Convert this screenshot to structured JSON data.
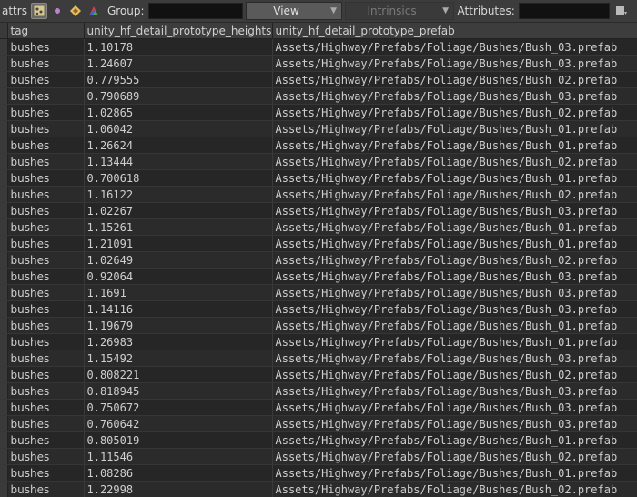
{
  "toolbar": {
    "label": "attrs",
    "group_label": "Group:",
    "group_value": "",
    "view_label": "View",
    "intrinsics_label": "Intrinsics",
    "attributes_label": "Attributes:",
    "attributes_value": ""
  },
  "table": {
    "columns": [
      "tag",
      "unity_hf_detail_prototype_heightscale",
      "unity_hf_detail_prototype_prefab"
    ],
    "rows": [
      [
        "bushes",
        "1.10178",
        "Assets/Highway/Prefabs/Foliage/Bushes/Bush_03.prefab"
      ],
      [
        "bushes",
        "1.24607",
        "Assets/Highway/Prefabs/Foliage/Bushes/Bush_03.prefab"
      ],
      [
        "bushes",
        "0.779555",
        "Assets/Highway/Prefabs/Foliage/Bushes/Bush_02.prefab"
      ],
      [
        "bushes",
        "0.790689",
        "Assets/Highway/Prefabs/Foliage/Bushes/Bush_03.prefab"
      ],
      [
        "bushes",
        "1.02865",
        "Assets/Highway/Prefabs/Foliage/Bushes/Bush_02.prefab"
      ],
      [
        "bushes",
        "1.06042",
        "Assets/Highway/Prefabs/Foliage/Bushes/Bush_01.prefab"
      ],
      [
        "bushes",
        "1.26624",
        "Assets/Highway/Prefabs/Foliage/Bushes/Bush_01.prefab"
      ],
      [
        "bushes",
        "1.13444",
        "Assets/Highway/Prefabs/Foliage/Bushes/Bush_02.prefab"
      ],
      [
        "bushes",
        "0.700618",
        "Assets/Highway/Prefabs/Foliage/Bushes/Bush_01.prefab"
      ],
      [
        "bushes",
        "1.16122",
        "Assets/Highway/Prefabs/Foliage/Bushes/Bush_02.prefab"
      ],
      [
        "bushes",
        "1.02267",
        "Assets/Highway/Prefabs/Foliage/Bushes/Bush_03.prefab"
      ],
      [
        "bushes",
        "1.15261",
        "Assets/Highway/Prefabs/Foliage/Bushes/Bush_01.prefab"
      ],
      [
        "bushes",
        "1.21091",
        "Assets/Highway/Prefabs/Foliage/Bushes/Bush_01.prefab"
      ],
      [
        "bushes",
        "1.02649",
        "Assets/Highway/Prefabs/Foliage/Bushes/Bush_02.prefab"
      ],
      [
        "bushes",
        "0.92064",
        "Assets/Highway/Prefabs/Foliage/Bushes/Bush_03.prefab"
      ],
      [
        "bushes",
        "1.1691",
        "Assets/Highway/Prefabs/Foliage/Bushes/Bush_03.prefab"
      ],
      [
        "bushes",
        "1.14116",
        "Assets/Highway/Prefabs/Foliage/Bushes/Bush_03.prefab"
      ],
      [
        "bushes",
        "1.19679",
        "Assets/Highway/Prefabs/Foliage/Bushes/Bush_01.prefab"
      ],
      [
        "bushes",
        "1.26983",
        "Assets/Highway/Prefabs/Foliage/Bushes/Bush_01.prefab"
      ],
      [
        "bushes",
        "1.15492",
        "Assets/Highway/Prefabs/Foliage/Bushes/Bush_03.prefab"
      ],
      [
        "bushes",
        "0.808221",
        "Assets/Highway/Prefabs/Foliage/Bushes/Bush_02.prefab"
      ],
      [
        "bushes",
        "0.818945",
        "Assets/Highway/Prefabs/Foliage/Bushes/Bush_03.prefab"
      ],
      [
        "bushes",
        "0.750672",
        "Assets/Highway/Prefabs/Foliage/Bushes/Bush_03.prefab"
      ],
      [
        "bushes",
        "0.760642",
        "Assets/Highway/Prefabs/Foliage/Bushes/Bush_03.prefab"
      ],
      [
        "bushes",
        "0.805019",
        "Assets/Highway/Prefabs/Foliage/Bushes/Bush_01.prefab"
      ],
      [
        "bushes",
        "1.11546",
        "Assets/Highway/Prefabs/Foliage/Bushes/Bush_02.prefab"
      ],
      [
        "bushes",
        "1.08286",
        "Assets/Highway/Prefabs/Foliage/Bushes/Bush_01.prefab"
      ],
      [
        "bushes",
        "1.22998",
        "Assets/Highway/Prefabs/Foliage/Bushes/Bush_02.prefab"
      ]
    ]
  },
  "icons": [
    "points-filter-icon",
    "point-icon",
    "vertex-icon",
    "primitive-icon",
    "options-icon"
  ],
  "colors": {
    "background": "#262626",
    "header": "#3d3d3d",
    "field": "#111111"
  }
}
